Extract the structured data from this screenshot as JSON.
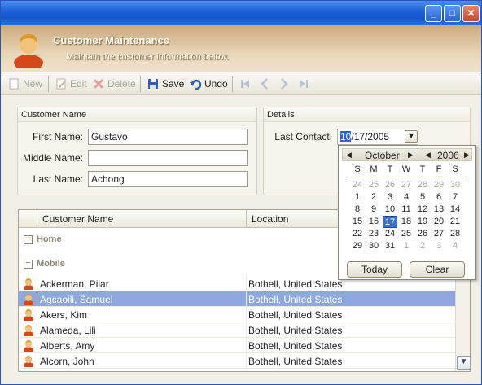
{
  "window": {
    "minimize": "_",
    "maximize": "□",
    "close": "✕"
  },
  "header": {
    "title": "Customer Maintenance",
    "subtitle": "Maintain the customer information below."
  },
  "toolbar": {
    "new": "New",
    "edit": "Edit",
    "delete": "Delete",
    "save": "Save",
    "undo": "Undo"
  },
  "customer_name": {
    "title": "Customer Name",
    "first_label": "First Name:",
    "first_value": "Gustavo",
    "middle_label": "Middle Name:",
    "middle_value": "",
    "last_label": "Last Name:",
    "last_value": "Achong"
  },
  "details": {
    "title": "Details",
    "last_contact_label": "Last Contact:",
    "last_contact_month": "10",
    "last_contact_rest": "/17/2005"
  },
  "calendar": {
    "month": "October",
    "year": "2006",
    "dows": [
      "S",
      "M",
      "T",
      "W",
      "T",
      "F",
      "S"
    ],
    "weeks": [
      [
        "24",
        "25",
        "26",
        "27",
        "28",
        "29",
        "30"
      ],
      [
        "1",
        "2",
        "3",
        "4",
        "5",
        "6",
        "7"
      ],
      [
        "8",
        "9",
        "10",
        "11",
        "12",
        "13",
        "14"
      ],
      [
        "15",
        "16",
        "17",
        "18",
        "19",
        "20",
        "21"
      ],
      [
        "22",
        "23",
        "24",
        "25",
        "26",
        "27",
        "28"
      ],
      [
        "29",
        "30",
        "31",
        "1",
        "2",
        "3",
        "4"
      ]
    ],
    "today": "Today",
    "clear": "Clear"
  },
  "grid": {
    "col_name": "Customer Name",
    "col_location": "Location",
    "group_home": "Home",
    "group_mobile": "Mobile",
    "rows": [
      {
        "name": "Ackerman, Pilar",
        "location": "Bothell, United States"
      },
      {
        "name": "Agcaoili, Samuel",
        "location": "Bothell, United States"
      },
      {
        "name": "Akers, Kim",
        "location": "Bothell, United States"
      },
      {
        "name": "Alameda, Lili",
        "location": "Bothell, United States"
      },
      {
        "name": "Alberts, Amy",
        "location": "Bothell, United States"
      },
      {
        "name": "Alcorn, John",
        "location": "Bothell, United States"
      }
    ]
  }
}
